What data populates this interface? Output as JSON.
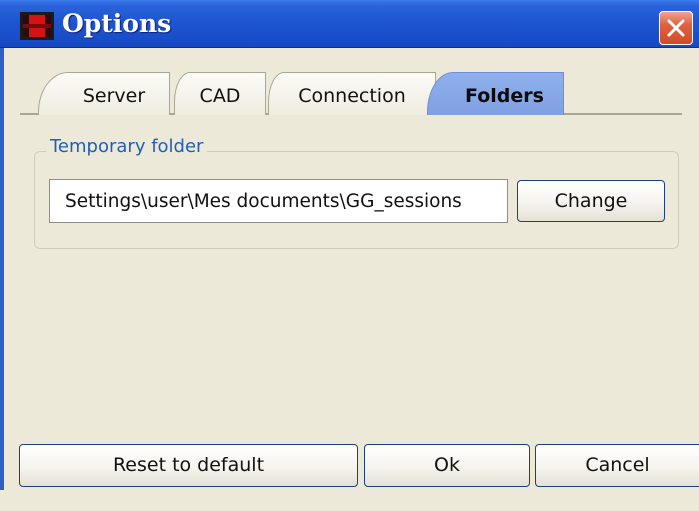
{
  "window": {
    "title": "Options",
    "icon": "app-icon"
  },
  "tabs": [
    {
      "label": "Server",
      "active": false
    },
    {
      "label": "CAD",
      "active": false
    },
    {
      "label": "Connection",
      "active": false
    },
    {
      "label": "Folders",
      "active": true
    }
  ],
  "temporary_folder": {
    "group_label": "Temporary folder",
    "path_value": "Settings\\user\\Mes documents\\GG_sessions",
    "change_label": "Change"
  },
  "footer": {
    "reset_label": "Reset to default",
    "ok_label": "Ok",
    "cancel_label": "Cancel"
  },
  "colors": {
    "titlebar": "#1e55d0",
    "active_tab": "#8fb0ec",
    "group_label": "#1f5fb9",
    "close_button": "#d24a27"
  }
}
